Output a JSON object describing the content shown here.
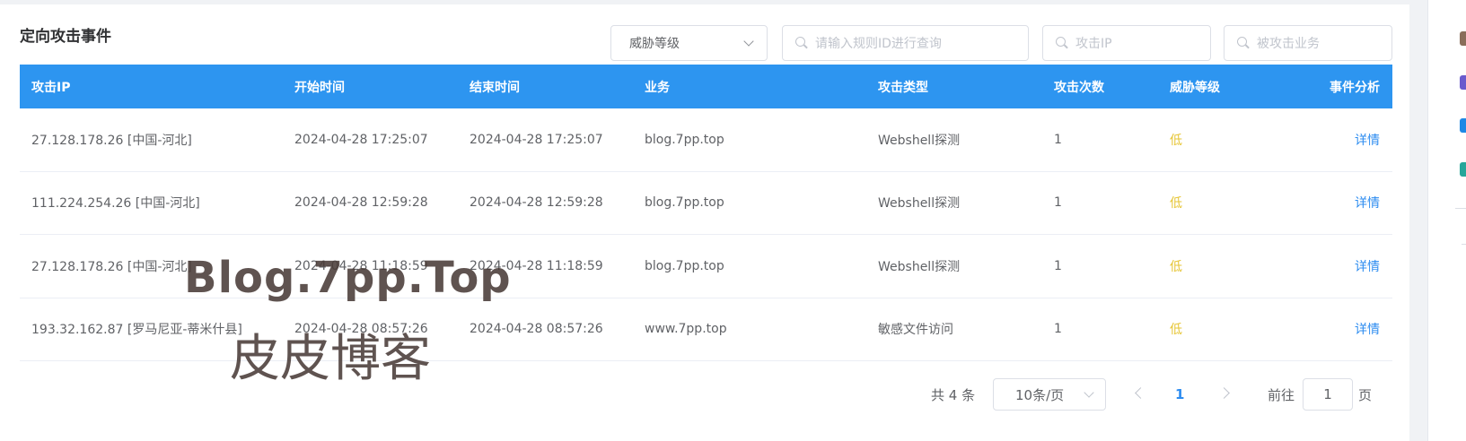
{
  "title": "定向攻击事件",
  "filters": {
    "level_select": "威胁等级",
    "rule_placeholder": "请输入规则ID进行查询",
    "ip_placeholder": "攻击IP",
    "biz_placeholder": "被攻击业务"
  },
  "table": {
    "headers": [
      "攻击IP",
      "开始时间",
      "结束时间",
      "业务",
      "攻击类型",
      "攻击次数",
      "威胁等级",
      "事件分析"
    ],
    "rows": [
      [
        "27.128.178.26 [中国-河北]",
        "2024-04-28 17:25:07",
        "2024-04-28 17:25:07",
        "blog.7pp.top",
        "Webshell探测",
        "1",
        "低",
        "详情"
      ],
      [
        "111.224.254.26 [中国-河北]",
        "2024-04-28 12:59:28",
        "2024-04-28 12:59:28",
        "blog.7pp.top",
        "Webshell探测",
        "1",
        "低",
        "详情"
      ],
      [
        "27.128.178.26 [中国-河北]",
        "2024-04-28 11:18:59",
        "2024-04-28 11:18:59",
        "blog.7pp.top",
        "Webshell探测",
        "1",
        "低",
        "详情"
      ],
      [
        "193.32.162.87 [罗马尼亚-蒂米什县]",
        "2024-04-28 08:57:26",
        "2024-04-28 08:57:26",
        "www.7pp.top",
        "敏感文件访问",
        "1",
        "低",
        "详情"
      ]
    ]
  },
  "pagination": {
    "total": "共 4 条",
    "page_size": "10条/页",
    "current_page": "1",
    "goto_label": "前往",
    "goto_value": "1",
    "goto_suffix": "页"
  },
  "watermark": {
    "line1": "Blog.7pp.Top",
    "line2": "皮皮博客"
  },
  "colors": {
    "header_bg": "#2d95f0",
    "link": "#2d8cf0",
    "low_level": "#e6c534"
  }
}
